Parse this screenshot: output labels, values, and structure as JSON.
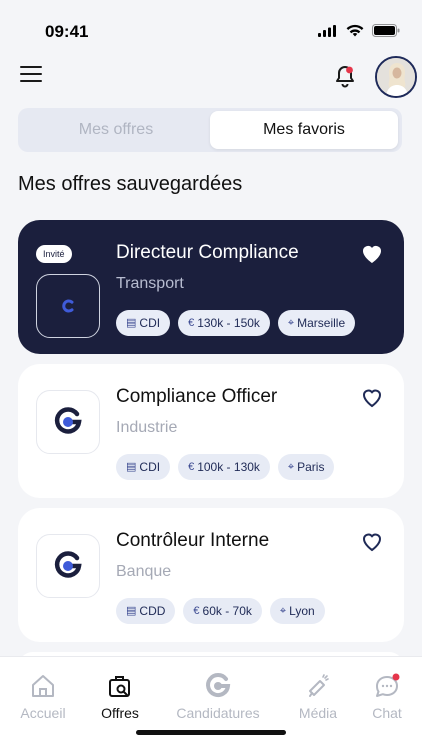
{
  "status_bar": {
    "time": "09:41"
  },
  "tabs": {
    "inactive_label": "Mes offres",
    "active_label": "Mes favoris"
  },
  "section_title": "Mes offres sauvegardées",
  "cards": [
    {
      "title": "Directeur Compliance",
      "subtitle": "Transport",
      "badge": "Invité",
      "tags": [
        "CDI",
        "130k - 150k",
        "Marseille"
      ],
      "favorited": true
    },
    {
      "title": "Compliance Officer",
      "subtitle": "Industrie",
      "tags": [
        "CDI",
        "100k - 130k",
        "Paris"
      ],
      "favorited": false
    },
    {
      "title": "Contrôleur Interne",
      "subtitle": "Banque",
      "tags": [
        "CDD",
        "60k - 70k",
        "Lyon"
      ],
      "favorited": false
    }
  ],
  "nav": [
    {
      "label": "Accueil",
      "icon": "home-icon"
    },
    {
      "label": "Offres",
      "icon": "briefcase-search-icon",
      "active": true
    },
    {
      "label": "Candidatures",
      "icon": "logo-g-icon"
    },
    {
      "label": "Média",
      "icon": "megaphone-icon"
    },
    {
      "label": "Chat",
      "icon": "chat-bubble-icon"
    }
  ],
  "colors": {
    "dark_card": "#1b1f3d",
    "accent": "#1f2a56",
    "notification_dot": "#e5364b"
  }
}
